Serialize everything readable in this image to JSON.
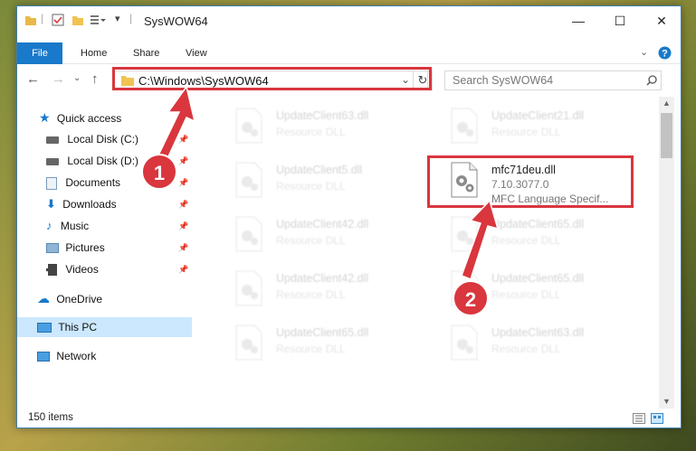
{
  "window": {
    "title": "SysWOW64"
  },
  "ribbon": {
    "tabs": [
      "File",
      "Home",
      "Share",
      "View"
    ]
  },
  "address": {
    "path": "C:\\Windows\\SysWOW64"
  },
  "search": {
    "placeholder": "Search SysWOW64"
  },
  "sidebar": {
    "items": [
      {
        "label": "Quick access",
        "icon": "star-icon"
      },
      {
        "label": "Local Disk (C:)",
        "icon": "drive-icon",
        "pinned": true
      },
      {
        "label": "Local Disk (D:)",
        "icon": "drive-icon",
        "pinned": true
      },
      {
        "label": "Documents",
        "icon": "documents-icon",
        "pinned": true
      },
      {
        "label": "Downloads",
        "icon": "download-icon",
        "pinned": true
      },
      {
        "label": "Music",
        "icon": "music-icon",
        "pinned": true
      },
      {
        "label": "Pictures",
        "icon": "pictures-icon",
        "pinned": true
      },
      {
        "label": "Videos",
        "icon": "videos-icon",
        "pinned": true
      },
      {
        "label": "OneDrive",
        "icon": "cloud-icon"
      },
      {
        "label": "This PC",
        "icon": "computer-icon",
        "selected": true
      },
      {
        "label": "Network",
        "icon": "network-icon"
      }
    ]
  },
  "files": [
    {
      "name": "UpdateClient63.dll",
      "sub1": "Resource DLL"
    },
    {
      "name": "UpdateClient21.dll",
      "sub1": "Resource DLL"
    },
    {
      "name": "UpdateClient5.dll",
      "sub1": "Resource DLL"
    },
    {
      "name": "mfc71deu.dll",
      "sub1": "7.10.3077.0",
      "sub2": "MFC Language Specif...",
      "highlighted": true
    },
    {
      "name": "UpdateClient42.dll",
      "sub1": "Resource DLL"
    },
    {
      "name": "UpdateClient65.dll",
      "sub1": "Resource DLL"
    },
    {
      "name": "UpdateClient42.dll",
      "sub1": "Resource DLL"
    },
    {
      "name": "UpdateClient65.dll",
      "sub1": "Resource DLL"
    },
    {
      "name": "UpdateClient65.dll",
      "sub1": "Resource DLL"
    },
    {
      "name": "UpdateClient63.dll",
      "sub1": "Resource DLL"
    }
  ],
  "status": {
    "item_count": "150 items"
  },
  "annotations": {
    "step1": "1",
    "step2": "2"
  },
  "colors": {
    "accent": "#1979ca",
    "annotation": "#d9363e",
    "selected": "#cce8ff"
  }
}
